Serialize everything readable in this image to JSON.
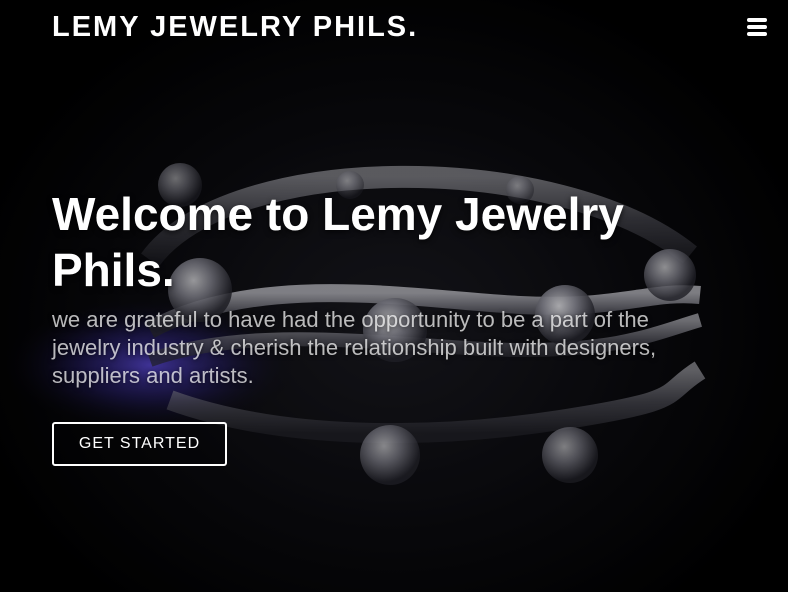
{
  "header": {
    "brand": "LEMY JEWELRY PHILS.",
    "menu_icon": "hamburger-menu-icon"
  },
  "hero": {
    "title": "Welcome to Lemy Jewelry Phils.",
    "subtitle": "we are grateful to have had the opportunity to be a part of the jewelry industry & cherish the relationship built with designers, suppliers and artists.",
    "cta_label": "GET STARTED",
    "background_image": "diamond-bracelet-photo"
  },
  "colors": {
    "background": "#000000",
    "text": "#ffffff",
    "glow": "#5a4cff"
  }
}
